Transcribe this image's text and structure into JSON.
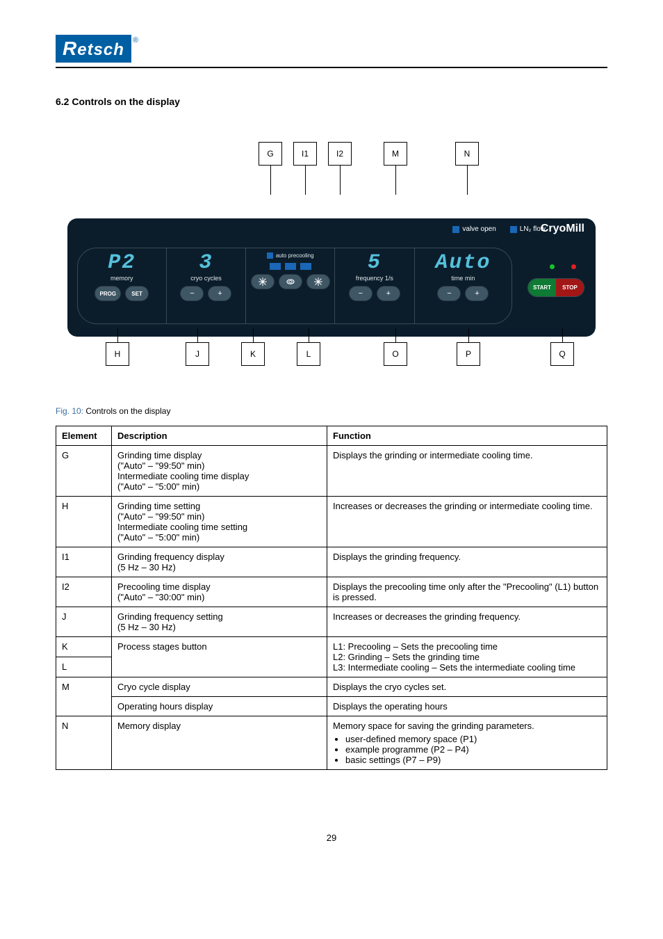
{
  "logo_text": "Retsch",
  "logo_reg": "®",
  "section_title": "6.2 Controls on the display",
  "panel": {
    "ind_valve": "valve open",
    "ind_ln2": "LN₂ flow",
    "brand": "CryoMill",
    "seg_memory": {
      "readout": "P2",
      "cap": "memory",
      "btn_prog": "PROG",
      "btn_set": "SET"
    },
    "seg_cycles": {
      "readout": "3",
      "cap": "cryo cycles",
      "btn_minus": "−",
      "btn_plus": "+"
    },
    "seg_precool": {
      "autolabel": "auto precooling"
    },
    "seg_freq": {
      "readout": "5",
      "cap": "frequency 1/s",
      "btn_minus": "−",
      "btn_plus": "+"
    },
    "seg_time": {
      "readout": "Auto",
      "cap": "time min",
      "btn_minus": "−",
      "btn_plus": "+"
    },
    "start": "START",
    "stop": "STOP"
  },
  "callouts": {
    "top": [
      "G",
      "I1",
      "I2",
      "M",
      "N"
    ],
    "bottom": [
      "H",
      "J",
      "K",
      "L",
      "O",
      "P",
      "Q"
    ]
  },
  "fig_label": "Fig. 10:",
  "fig_caption": "Controls on the display",
  "table": {
    "hdr_el": "Element",
    "hdr_desc": "Description",
    "hdr_fun": "Function",
    "rows": [
      {
        "el": "G",
        "desc_lines": [
          "Grinding time display",
          "(\"Auto\" – \"99:50\" min)",
          "Intermediate cooling time display",
          "(\"Auto\" – \"5:00\" min)"
        ],
        "fun": "Displays the grinding or intermediate cooling time."
      },
      {
        "el": "H",
        "desc_lines": [
          "Grinding time setting",
          "(\"Auto\" – \"99:50\" min)",
          "Intermediate cooling time setting",
          "(\"Auto\" – \"5:00\" min)"
        ],
        "fun": "Increases or decreases the grinding or intermediate cooling time."
      },
      {
        "el": "I1",
        "desc_lines": [
          "Grinding frequency display",
          "(5 Hz – 30 Hz)"
        ],
        "fun": "Displays the grinding frequency."
      },
      {
        "el": "I2",
        "desc_lines": [
          "Precooling time display",
          "(\"Auto\" – \"30:00\" min)"
        ],
        "fun": "Displays the precooling time only after the \"Precooling\" (L1) button is pressed."
      },
      {
        "el": "J",
        "desc_lines": [
          "Grinding frequency setting",
          "(5 Hz – 30 Hz)"
        ],
        "fun": "Increases or decreases the grinding frequency."
      },
      {
        "el": "K",
        "desc_lines": [
          "Process stages button"
        ],
        "fun": "L1: Precooling – Sets the precooling time",
        "fun2": "L2: Grinding – Sets the grinding time",
        "fun3": "L3: Intermediate cooling – Sets the intermediate cooling time"
      },
      {
        "el": "L",
        "desc_lines": [
          "Process stages button"
        ],
        "fun": "L1: Precooling – Sets the precooling time",
        "fun2": "L2: Grinding – Sets the grinding time",
        "fun3": "L3: Intermediate cooling – Sets the intermediate cooling time"
      },
      {
        "el": "M_row1",
        "desc_lines": [
          "Cryo cycle display"
        ],
        "fun": "Displays the cryo cycles set."
      },
      {
        "el": "M_row2",
        "desc_lines": [
          "Operating hours display"
        ],
        "fun": "Displays the operating hours"
      },
      {
        "el": "N",
        "desc_lines": [
          "Memory display"
        ],
        "fun_lines": [
          "Memory space for saving the grinding parameters.",
          "bullet:user-defined memory space (P1)",
          "bullet:example programme (P2 – P4)",
          "bullet:basic settings (P7 – P9)"
        ]
      }
    ]
  },
  "page_number": "29"
}
